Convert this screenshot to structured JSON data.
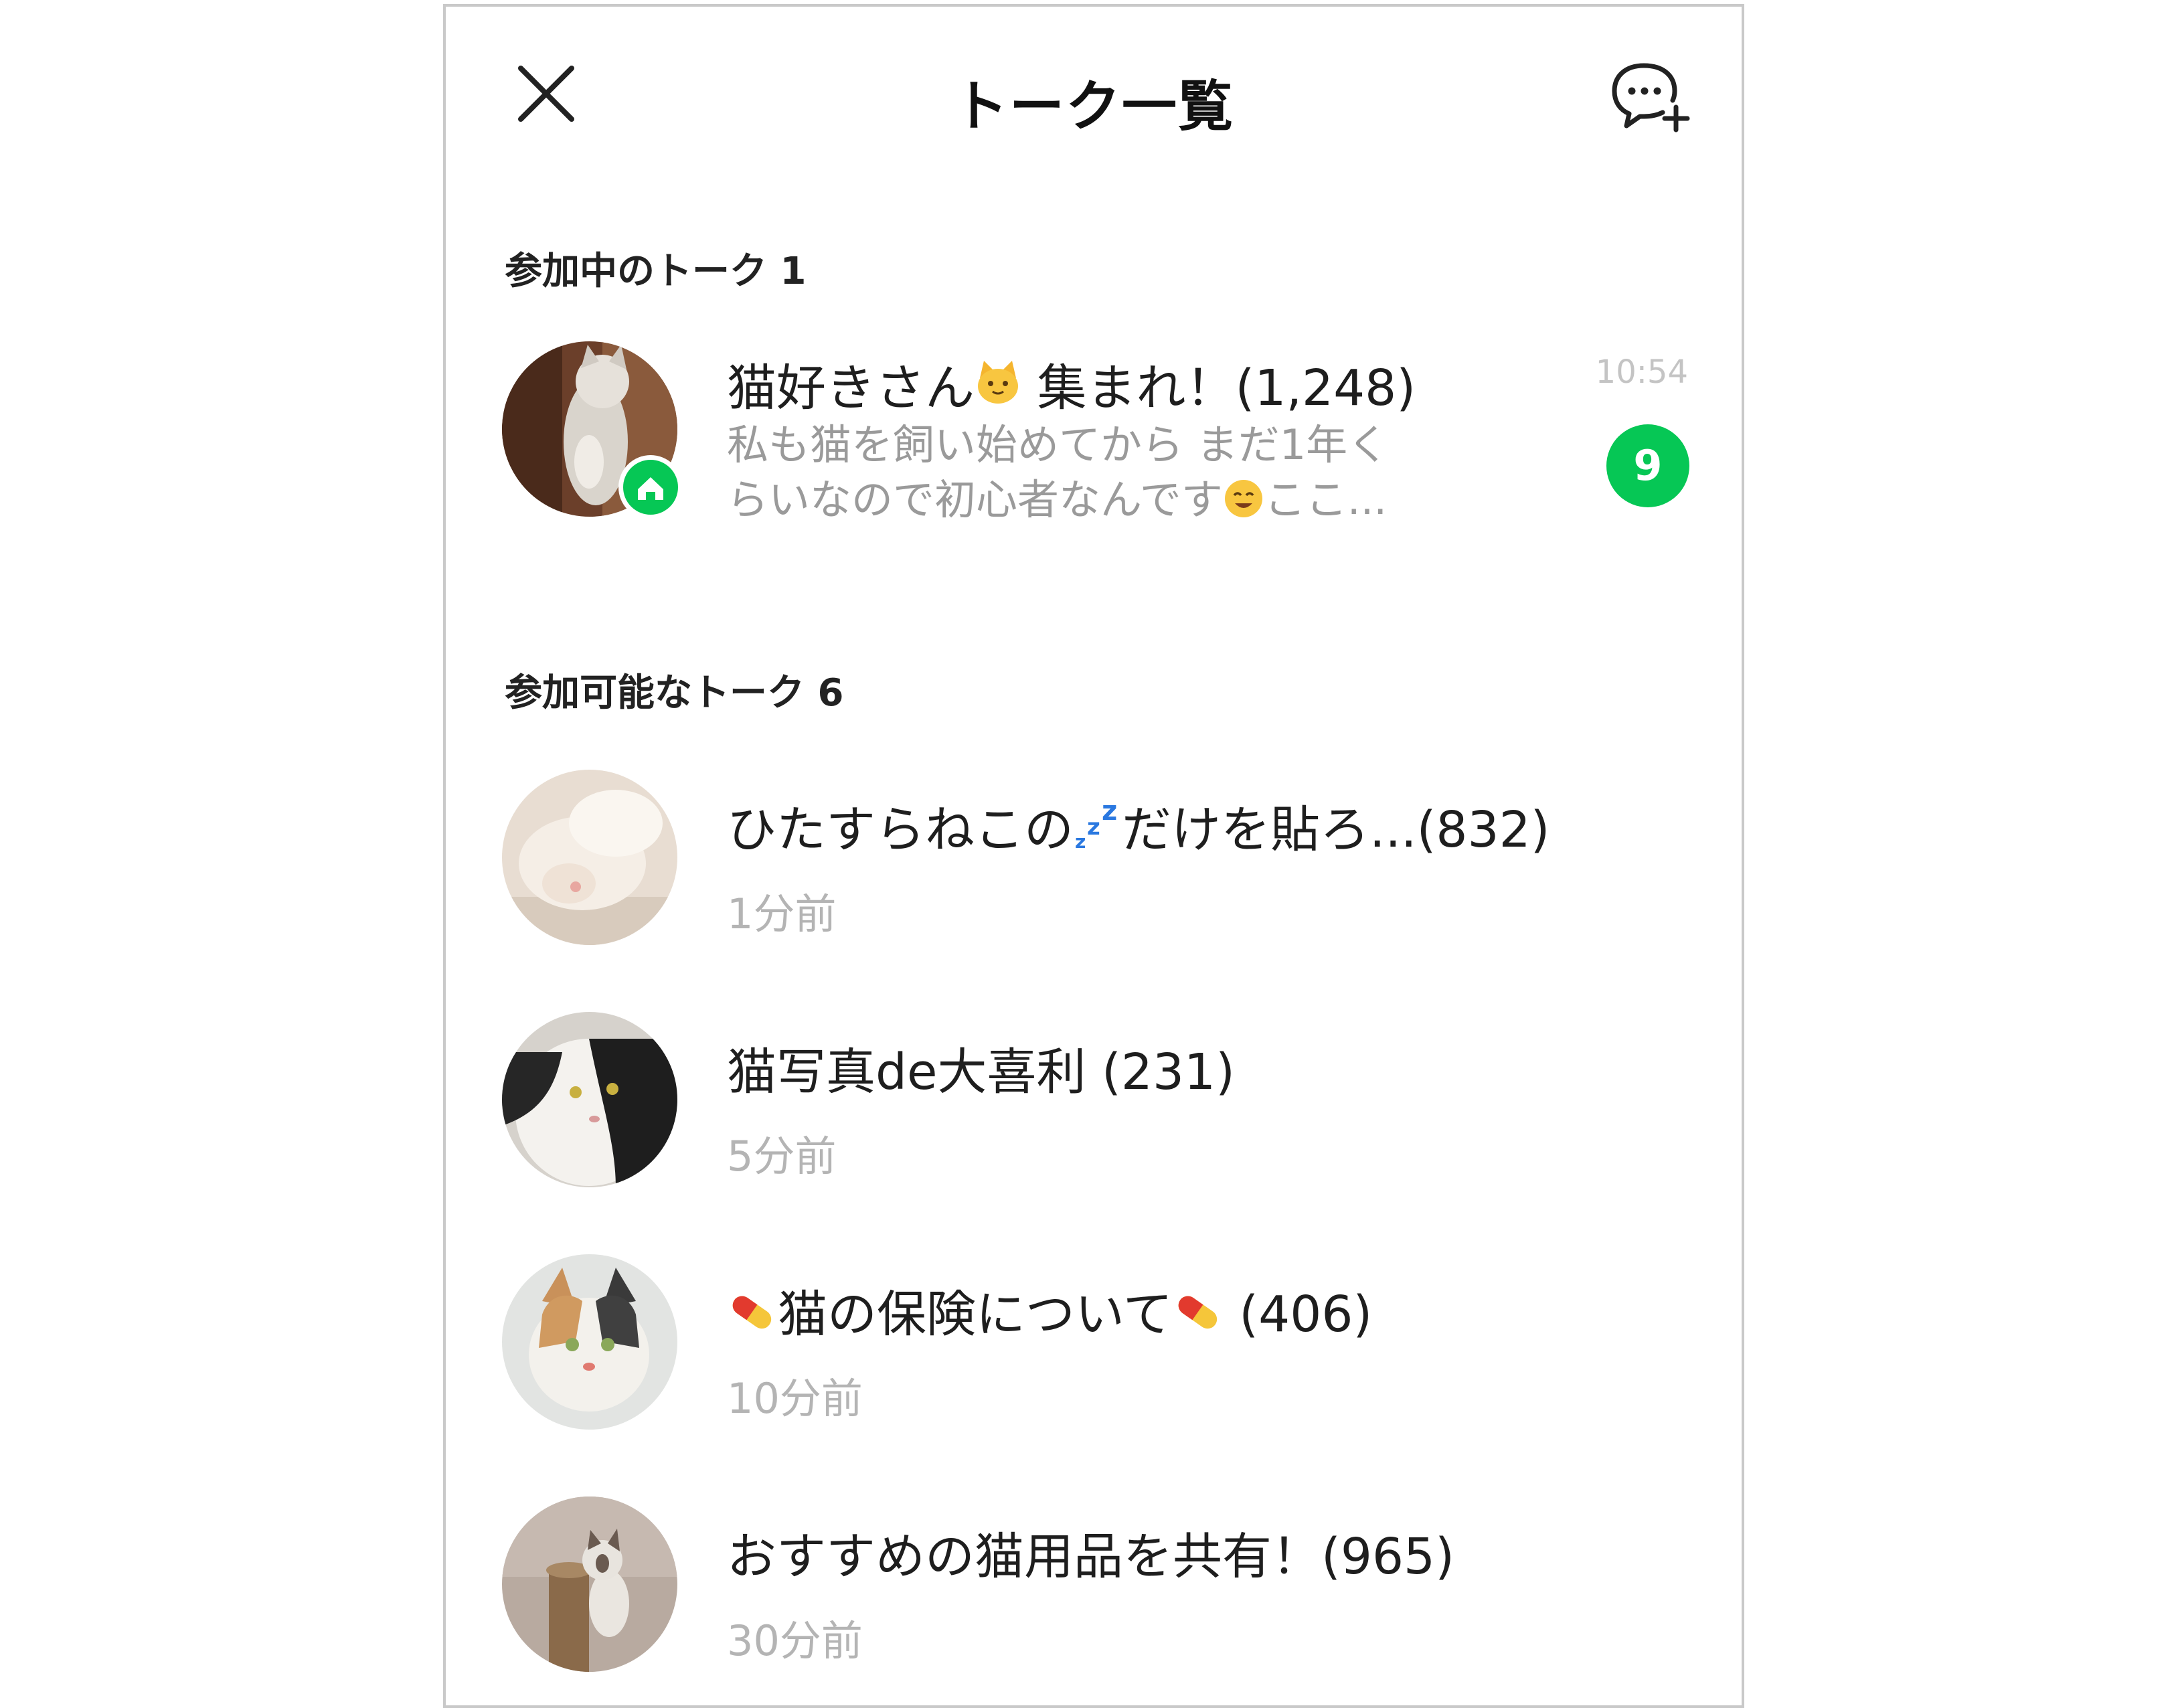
{
  "header": {
    "title": "トーク一覧",
    "close_icon": "close-icon",
    "new_chat_icon": "new-chat-bubble-plus-icon"
  },
  "joined": {
    "section_title": "参加中のトーク 1",
    "items": [
      {
        "name_prefix": "猫好きさん",
        "name_emoji": "cat-face-emoji",
        "name_suffix": " 集まれ！(1,248)",
        "preview_line1": "私も猫を飼い始めてから まだ1年く",
        "preview_line2_before": "らいなので初心者なんです",
        "preview_emoji": "smiling-face-emoji",
        "preview_line2_after": "ここ...",
        "time": "10:54",
        "unread": "9",
        "badge_icon": "home-icon"
      }
    ]
  },
  "available": {
    "section_title": "参加可能なトーク 6",
    "items": [
      {
        "name_prefix": "ひたすらねこの",
        "name_emoji": "zzz-emoji",
        "name_suffix": "だけを貼ろ...(832)",
        "sub": "1分前",
        "avatar": "sleeping-white-cat"
      },
      {
        "name_prefix": "猫写真de大喜利 (231)",
        "name_emoji": "",
        "name_suffix": "",
        "sub": "5分前",
        "avatar": "black-white-cat"
      },
      {
        "name_prefix": "",
        "name_emoji": "pill-emoji",
        "name_middle": "猫の保険について",
        "name_suffix": " (406)",
        "sub": "10分前",
        "avatar": "calico-cat"
      },
      {
        "name_prefix": "おすすめの猫用品を共有！(965)",
        "name_emoji": "",
        "name_suffix": "",
        "sub": "30分前",
        "avatar": "cat-on-post"
      }
    ]
  },
  "colors": {
    "accent_green": "#06c755",
    "text_primary": "#1e1e1e",
    "text_secondary": "#b4b4b4",
    "frame_border": "#c9c9c9"
  }
}
